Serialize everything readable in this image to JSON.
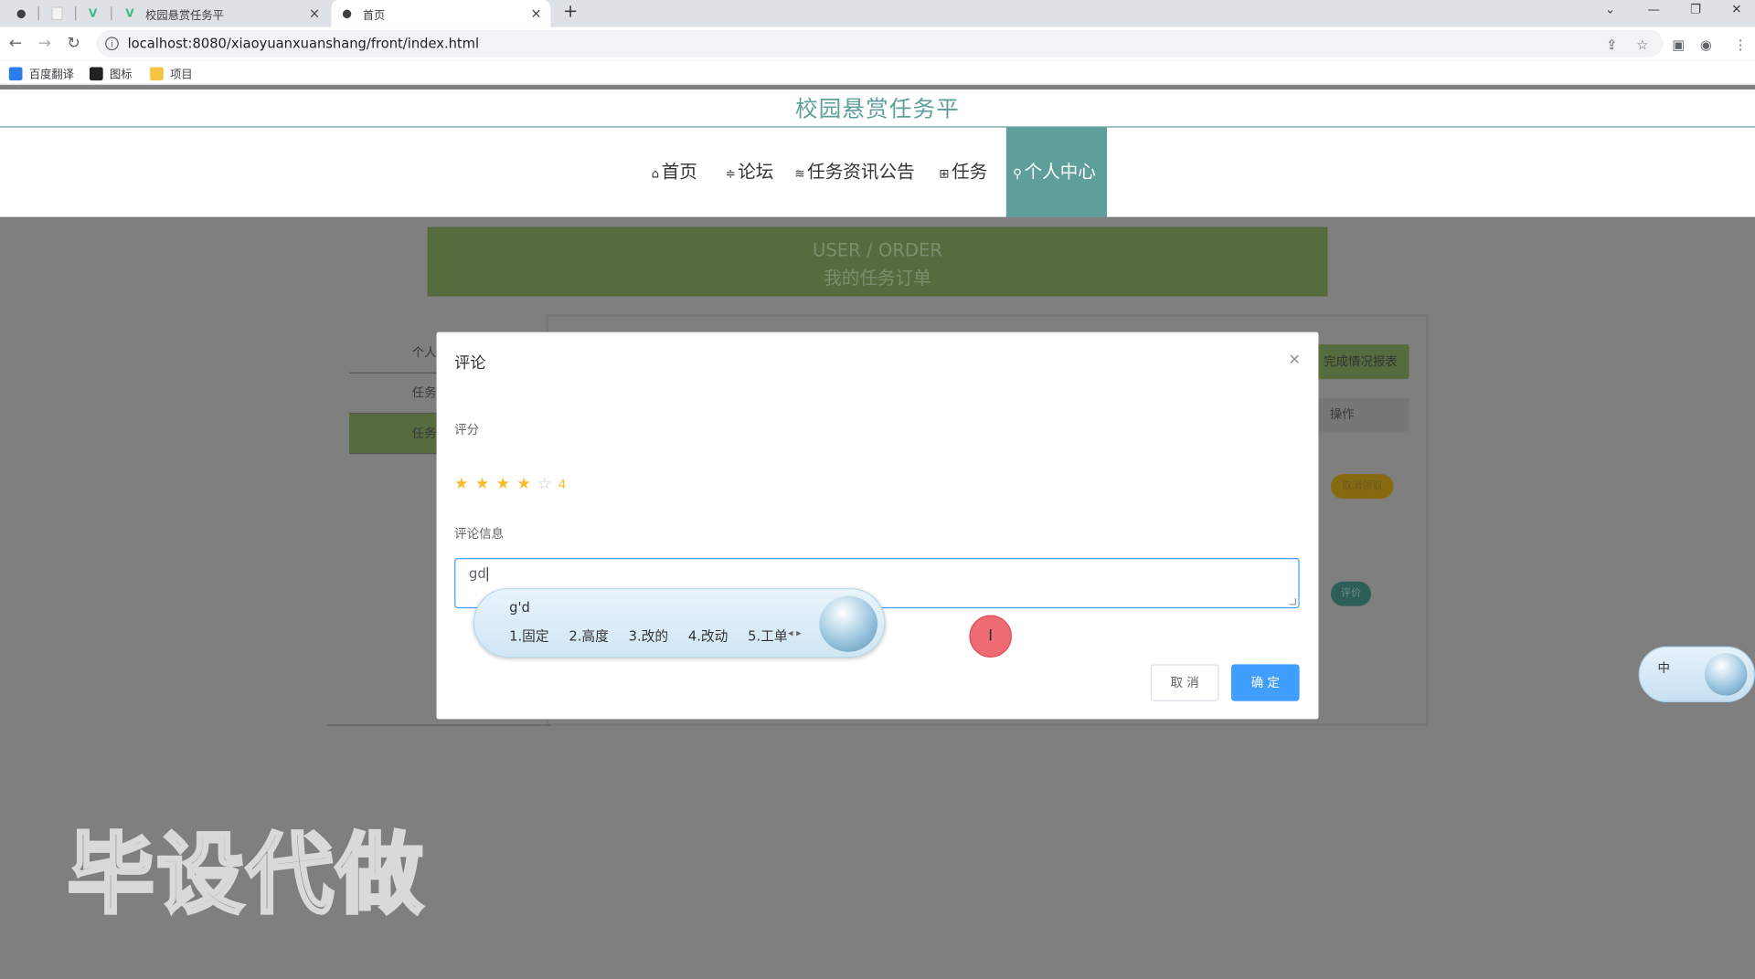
{
  "browser": {
    "tabs": [
      {
        "label": "校园悬赏任务平"
      },
      {
        "label": "首页"
      }
    ],
    "new_tab": "+",
    "url": "localhost:8080/xiaoyuanxuanshang/front/index.html",
    "bookmarks": [
      {
        "label": "百度翻译"
      },
      {
        "label": "图标"
      },
      {
        "label": "项目"
      }
    ]
  },
  "site": {
    "title": "校园悬赏任务平",
    "menu": [
      {
        "icon": "home-icon",
        "label": "首页"
      },
      {
        "icon": "forum-icon",
        "label": "论坛"
      },
      {
        "icon": "news-icon",
        "label": "任务资讯公告"
      },
      {
        "icon": "task-icon",
        "label": "任务"
      },
      {
        "icon": "user-icon",
        "label": "个人中心"
      }
    ],
    "banner_en": "USER / ORDER",
    "banner_cn": "我的任务订单",
    "side": [
      "个人",
      "任务",
      "任务"
    ],
    "report_button": "完成情况报表",
    "op_header": "操作",
    "pill_cancel": "取消领取",
    "pill_review": "评价"
  },
  "dialog": {
    "title": "评论",
    "score_label": "评分",
    "rating": 4,
    "rating_max": 5,
    "rating_text": "4",
    "comment_label": "评论信息",
    "comment_value": "gd",
    "cancel": "取 消",
    "ok": "确 定"
  },
  "ime": {
    "input": "g'd",
    "candidates": [
      "1.固定",
      "2.高度",
      "3.改的",
      "4.改动",
      "5.工单"
    ],
    "mini_label": "中"
  },
  "watermark": "毕设代做",
  "colors": {
    "accent": "#5e9f9b",
    "primary_button": "#409eff",
    "star": "#f7ba2a",
    "banner": "#576c3e"
  }
}
